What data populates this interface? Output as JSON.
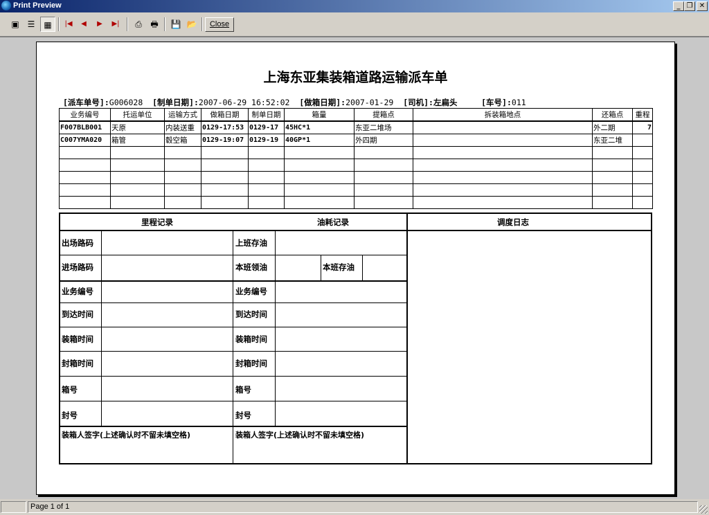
{
  "window": {
    "title": "Print Preview"
  },
  "toolbar": {
    "close_label": "Close"
  },
  "document": {
    "title": "上海东亚集装箱道路运输派车单",
    "header": {
      "dispatch_no_label": "[派车单号]:",
      "dispatch_no": "G006028",
      "issue_date_label": "[制单日期]:",
      "issue_date": "2007-06-29 16:52:02",
      "box_date_label": "[做箱日期]:",
      "box_date": "2007-01-29",
      "driver_label": "[司机]:",
      "driver": "左扁头",
      "truck_label": "[车号]:",
      "truck": "011"
    },
    "table": {
      "columns": [
        "业务编号",
        "托运单位",
        "运输方式",
        "做箱日期",
        "制单日期",
        "箱量",
        "提箱点",
        "拆装箱地点",
        "还箱点",
        "重程"
      ],
      "rows": [
        [
          "F007BLB001",
          "天原",
          "内装送重",
          "0129-17:53",
          "0129-17",
          "45HC*1",
          "东亚二堆场",
          "",
          "外二期",
          "7"
        ],
        [
          "C007YMA020",
          "箱管",
          "毂空箱",
          "0129-19:07",
          "0129-19",
          "40GP*1",
          "外四期",
          "",
          "东亚二堆",
          ""
        ]
      ]
    },
    "lower": {
      "mileage_label": "里程记录",
      "fuel_label": "油耗记录",
      "dispatch_log_label": "调度日志",
      "exit_route": "出场路码",
      "entry_route": "进场路码",
      "shift_start_fuel": "上班存油",
      "shift_fuel_received": "本班领油",
      "shift_fuel_left": "本班存油",
      "business_no": "业务编号",
      "arrival_time": "到达时间",
      "loading_time": "装箱时间",
      "sealing_time": "封箱时间",
      "container_no": "箱号",
      "seal_no": "封号",
      "signature": "装箱人签字(上述确认时不留未填空格)"
    }
  },
  "status": {
    "page": "Page 1 of 1"
  }
}
